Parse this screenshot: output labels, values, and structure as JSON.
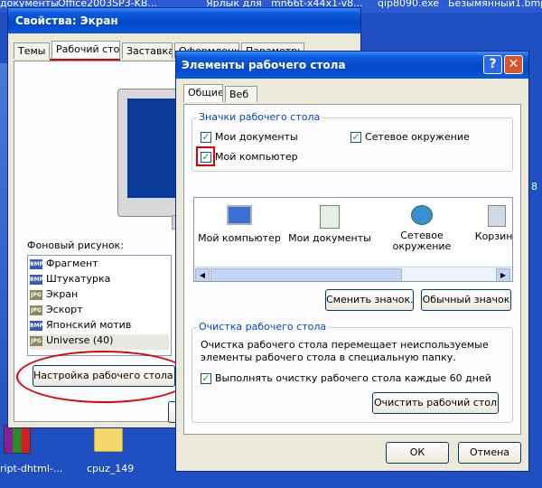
{
  "desktop": {
    "top_items": [
      "документы",
      "Office2003SP3-KB...",
      "Ярлык для",
      "mn66t-x44x1-v8...",
      "qip8090.exe",
      "Безымянный1.bmp"
    ],
    "bottom_items": [
      "ript-dhtml-...",
      "cpuz_149"
    ],
    "side_digit": "8"
  },
  "display_window": {
    "title": "Свойства: Экран",
    "tabs": [
      "Темы",
      "Рабочий стол",
      "Заставка",
      "Оформление",
      "Параметры"
    ],
    "background_label": "Фоновый рисунок:",
    "wallpapers": [
      {
        "name": "Фрагмент",
        "icon": "bmp"
      },
      {
        "name": "Штукатурка",
        "icon": "bmp"
      },
      {
        "name": "Экран",
        "icon": "jpg"
      },
      {
        "name": "Эскорт",
        "icon": "jpg"
      },
      {
        "name": "Японский мотив",
        "icon": "bmp"
      },
      {
        "name": "Universe (40)",
        "icon": "jpg"
      }
    ],
    "customize_button": "Настройка рабочего стола...",
    "partial_button": "О"
  },
  "dialog": {
    "title": "Элементы рабочего стола",
    "help_label": "?",
    "close_label": "✕",
    "tabs": [
      "Общие",
      "Веб"
    ],
    "icons_group": {
      "title": "Значки рабочего стола",
      "checkboxes": [
        {
          "label": "Мои документы",
          "checked": true
        },
        {
          "label": "Сетевое окружение",
          "checked": true
        },
        {
          "label": "Мой компьютер",
          "checked": true
        }
      ]
    },
    "icon_list": [
      {
        "label": "Мой компьютер",
        "icon": "my-computer-icon"
      },
      {
        "label": "Мои документы",
        "icon": "my-documents-icon"
      },
      {
        "label": "Сетевое окружение",
        "icon": "network-icon"
      },
      {
        "label": "Корзина",
        "icon": "recycle-bin-icon"
      }
    ],
    "change_icon_button": "Сменить значок...",
    "default_icon_button": "Обычный значок",
    "cleanup_group": {
      "title": "Очистка рабочего стола",
      "description": "Очистка рабочего стола перемещает неиспользуемые элементы рабочего стола в специальную папку.",
      "checkbox_label": "Выполнять очистку рабочего стола каждые 60 дней",
      "checkbox_checked": true,
      "cleanup_button": "Очистить рабочий стол"
    },
    "ok_button": "ОК",
    "cancel_button": "Отмена"
  },
  "colors": {
    "highlight": "#e00000",
    "accent_blue": "#0046d5",
    "desktop": "#1f4fc0"
  }
}
